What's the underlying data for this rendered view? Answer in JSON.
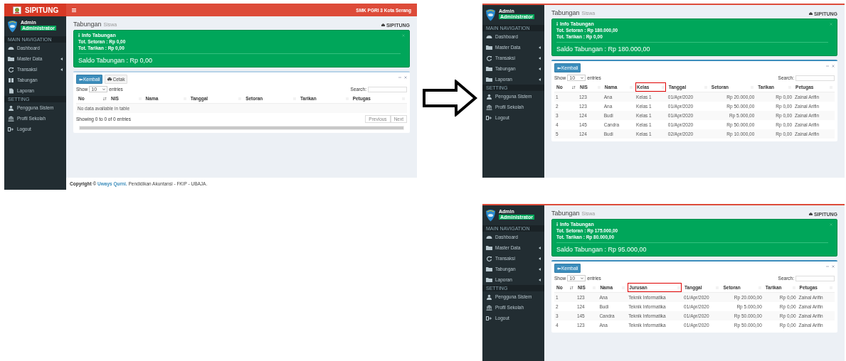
{
  "shots": [
    {
      "header": {
        "brand": "SIPITUNG",
        "school": "SMK PGRI 3 Kota Serang"
      },
      "sidebar": {
        "user": "Admin",
        "role": "Administrator",
        "sections": [
          {
            "heading": "MAIN NAVIGATION",
            "items": [
              {
                "label": "Dashboard",
                "kind": "dashboard",
                "has_submenu": false
              },
              {
                "label": "Master Data",
                "kind": "folder",
                "has_submenu": true
              },
              {
                "label": "Transaksi",
                "kind": "refresh",
                "has_submenu": true
              },
              {
                "label": "Tabungan",
                "kind": "book",
                "has_submenu": false
              },
              {
                "label": "Laporan",
                "kind": "file",
                "has_submenu": false
              }
            ]
          },
          {
            "heading": "SETTING",
            "items": [
              {
                "label": "Pengguna Sistem",
                "kind": "user",
                "has_submenu": false
              },
              {
                "label": "Profil Sekolah",
                "kind": "bank",
                "has_submenu": false
              },
              {
                "label": "Logout",
                "kind": "logout",
                "has_submenu": false
              }
            ]
          }
        ]
      },
      "content": {
        "title": "Tabungan",
        "subtitle": "Siswa",
        "breadcrumb": "SIPITUNG",
        "info": {
          "title": "Info Tabungan",
          "lines": [
            "Tot. Setoran : Rp 0,00",
            "Tot. Tarikan : Rp 0,00"
          ],
          "balance": "Saldo Tabungan : Rp 0,00"
        },
        "buttons": [
          {
            "label": "Kembali",
            "kind": "primary"
          },
          {
            "label": "Cetak",
            "kind": "default"
          }
        ],
        "show_label": "Show",
        "length": "10",
        "entries_label": "entries",
        "search_label": "Search:",
        "columns": [
          {
            "label": "No",
            "sorted": true,
            "highlighted": false
          },
          {
            "label": "NIS",
            "sorted": false,
            "highlighted": false
          },
          {
            "label": "Nama",
            "sorted": false,
            "highlighted": false
          },
          {
            "label": "Tanggal",
            "sorted": false,
            "highlighted": false
          },
          {
            "label": "Setoran",
            "sorted": false,
            "highlighted": false
          },
          {
            "label": "Tarikan",
            "sorted": false,
            "highlighted": false
          },
          {
            "label": "Petugas",
            "sorted": false,
            "highlighted": false
          }
        ],
        "empty_text": "No data available in table",
        "info_text": "Showing 0 to 0 of 0 entries",
        "pager": [
          {
            "label": "Previous",
            "disabled": true
          },
          {
            "label": "Next",
            "disabled": true
          }
        ]
      },
      "footer_parts": {
        "lead": "Copyright ©",
        "link": "Uways Qurni.",
        "rest": "Pendidikan Akuntansi - FKIP - UBAJA."
      }
    },
    {
      "sidebar": {
        "user": "Admin",
        "role": "Administrator",
        "sections": [
          {
            "heading": "MAIN NAVIGATION",
            "items": [
              {
                "label": "Dashboard",
                "kind": "dashboard",
                "has_submenu": false
              },
              {
                "label": "Master Data",
                "kind": "folder",
                "has_submenu": true
              },
              {
                "label": "Transaksi",
                "kind": "refresh",
                "has_submenu": true
              },
              {
                "label": "Tabungan",
                "kind": "folder",
                "has_submenu": true
              },
              {
                "label": "Laporan",
                "kind": "folder",
                "has_submenu": true
              }
            ]
          },
          {
            "heading": "SETTING",
            "items": [
              {
                "label": "Pengguna Sistem",
                "kind": "user",
                "has_submenu": false
              },
              {
                "label": "Profil Sekolah",
                "kind": "bank",
                "has_submenu": false
              },
              {
                "label": "Logout",
                "kind": "logout",
                "has_submenu": false
              }
            ]
          }
        ]
      },
      "content": {
        "title": "Tabungan",
        "subtitle": "Siswa",
        "breadcrumb": "SIPITUNG",
        "info": {
          "title": "Info Tabungan",
          "lines": [
            "Tot. Setoran : Rp 180.000,00",
            "Tot. Tarikan : Rp 0,00"
          ],
          "balance": "Saldo Tabungan : Rp 180.000,00"
        },
        "buttons": [
          {
            "label": "Kembali",
            "kind": "primary"
          }
        ],
        "show_label": "Show",
        "length": "10",
        "entries_label": "entries",
        "search_label": "Search:",
        "columns": [
          {
            "label": "No",
            "sorted": true,
            "highlighted": false,
            "kind": "text"
          },
          {
            "label": "NIS",
            "sorted": false,
            "highlighted": false,
            "kind": "text"
          },
          {
            "label": "Nama",
            "sorted": false,
            "highlighted": false,
            "kind": "text"
          },
          {
            "label": "Kelas",
            "sorted": false,
            "highlighted": true,
            "kind": "text"
          },
          {
            "label": "Tanggal",
            "sorted": false,
            "highlighted": false,
            "kind": "text"
          },
          {
            "label": "Setoran",
            "sorted": false,
            "highlighted": false,
            "kind": "money"
          },
          {
            "label": "Tarikan",
            "sorted": false,
            "highlighted": false,
            "kind": "money"
          },
          {
            "label": "Petugas",
            "sorted": false,
            "highlighted": false,
            "kind": "text"
          }
        ],
        "rows": [
          [
            "1",
            "123",
            "Ana",
            "Kelas 1",
            "01/Apr/2020",
            "Rp 20.000,00",
            "Rp 0,00",
            "Zainal Arifin"
          ],
          [
            "2",
            "123",
            "Ana",
            "Kelas 1",
            "01/Apr/2020",
            "Rp 50.000,00",
            "Rp 0,00",
            "Zainal Arifin"
          ],
          [
            "3",
            "124",
            "Budi",
            "Kelas 1",
            "01/Apr/2020",
            "Rp 5.000,00",
            "Rp 0,00",
            "Zainal Arifin"
          ],
          [
            "4",
            "145",
            "Candra",
            "Kelas 1",
            "01/Apr/2020",
            "Rp 50.000,00",
            "Rp 0,00",
            "Zainal Arifin"
          ],
          [
            "5",
            "124",
            "Budi",
            "Kelas 1",
            "02/Apr/2020",
            "Rp 10.000,00",
            "Rp 0,00",
            "Zainal Arifin"
          ]
        ]
      }
    },
    {
      "sidebar": {
        "user": "Admin",
        "role": "Administrator",
        "sections": [
          {
            "heading": "MAIN NAVIGATION",
            "items": [
              {
                "label": "Dashboard",
                "kind": "dashboard",
                "has_submenu": false
              },
              {
                "label": "Master Data",
                "kind": "folder",
                "has_submenu": true
              },
              {
                "label": "Transaksi",
                "kind": "refresh",
                "has_submenu": true
              },
              {
                "label": "Tabungan",
                "kind": "folder",
                "has_submenu": true
              },
              {
                "label": "Laporan",
                "kind": "folder",
                "has_submenu": true
              }
            ]
          },
          {
            "heading": "SETTING",
            "items": [
              {
                "label": "Pengguna Sistem",
                "kind": "user",
                "has_submenu": false
              },
              {
                "label": "Profil Sekolah",
                "kind": "bank",
                "has_submenu": false
              },
              {
                "label": "Logout",
                "kind": "logout",
                "has_submenu": false
              }
            ]
          }
        ]
      },
      "content": {
        "title": "Tabungan",
        "subtitle": "Siswa",
        "breadcrumb": "SIPITUNG",
        "info": {
          "title": "Info Tabungan",
          "lines": [
            "Tot. Setoran : Rp 175.000,00",
            "Tot. Tarikan : Rp 80.000,00"
          ],
          "balance": "Saldo Tabungan : Rp 95.000,00"
        },
        "buttons": [
          {
            "label": "Kembali",
            "kind": "primary"
          }
        ],
        "show_label": "Show",
        "length": "10",
        "entries_label": "entries",
        "search_label": "Search:",
        "columns": [
          {
            "label": "No",
            "sorted": true,
            "highlighted": false,
            "kind": "text"
          },
          {
            "label": "NIS",
            "sorted": false,
            "highlighted": false,
            "kind": "text"
          },
          {
            "label": "Nama",
            "sorted": false,
            "highlighted": false,
            "kind": "text"
          },
          {
            "label": "Jurusan",
            "sorted": false,
            "highlighted": true,
            "kind": "text"
          },
          {
            "label": "Tanggal",
            "sorted": false,
            "highlighted": false,
            "kind": "text"
          },
          {
            "label": "Setoran",
            "sorted": false,
            "highlighted": false,
            "kind": "money"
          },
          {
            "label": "Tarikan",
            "sorted": false,
            "highlighted": false,
            "kind": "money"
          },
          {
            "label": "Petugas",
            "sorted": false,
            "highlighted": false,
            "kind": "text"
          }
        ],
        "rows": [
          [
            "1",
            "123",
            "Ana",
            "Teknik Informatika",
            "01/Apr/2020",
            "Rp 20.000,00",
            "Rp 0,00",
            "Zainal Arifin"
          ],
          [
            "2",
            "124",
            "Budi",
            "Teknik Informatika",
            "01/Apr/2020",
            "Rp 5.000,00",
            "Rp 0,00",
            "Zainal Arifin"
          ],
          [
            "3",
            "145",
            "Candra",
            "Teknik Informatika",
            "01/Apr/2020",
            "Rp 50.000,00",
            "Rp 0,00",
            "Zainal Arifin"
          ],
          [
            "4",
            "123",
            "Ana",
            "Teknik Informatika",
            "01/Apr/2020",
            "Rp 50.000,00",
            "Rp 0,00",
            "Zainal Arifin"
          ]
        ]
      }
    }
  ]
}
